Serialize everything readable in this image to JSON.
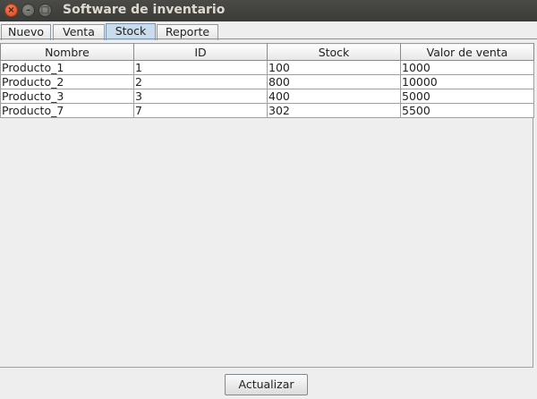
{
  "window": {
    "title": "Software de inventario",
    "close_glyph": "×",
    "min_glyph": "–",
    "max_glyph": "□"
  },
  "tabs": [
    {
      "label": "Nuevo",
      "active": false
    },
    {
      "label": "Venta",
      "active": false
    },
    {
      "label": "Stock",
      "active": true
    },
    {
      "label": "Reporte",
      "active": false
    }
  ],
  "table": {
    "columns": [
      "Nombre",
      "ID",
      "Stock",
      "Valor de venta"
    ],
    "rows": [
      [
        "Producto_1",
        "1",
        "100",
        "1000"
      ],
      [
        "Producto_2",
        "2",
        "800",
        "10000"
      ],
      [
        "Producto_3",
        "3",
        "400",
        "5000"
      ],
      [
        "Producto_7",
        "7",
        "302",
        "5500"
      ]
    ]
  },
  "actions": {
    "refresh_label": "Actualizar"
  },
  "colors": {
    "titlebar": "#3c3b37",
    "close_button": "#e0552a",
    "active_tab": "#c9dced"
  }
}
